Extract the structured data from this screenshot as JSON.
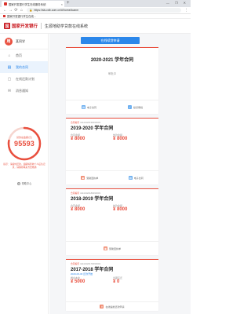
{
  "browser": {
    "tab_title": "国家开发银行学生在线服务系统",
    "tab_close": "×",
    "new_tab": "+",
    "window_controls": "— ❐ ✕",
    "back": "←",
    "forward": "→",
    "reload": "⟳",
    "home": "⌂",
    "lock": "🔒",
    "url": "https://sls.cdb.com.cn/#/home/loanm",
    "menu": "⋮",
    "bookmark_label": "国家开发银行学生在线..."
  },
  "header": {
    "logo_mark": "国",
    "logo_text": "国家开发银行",
    "site_title": "生源地助学贷款在线系统"
  },
  "sidebar": {
    "avatar_text": "用",
    "user_name": "某同学",
    "items": [
      {
        "icon": "home-icon",
        "glyph": "⌂",
        "label": "首页"
      },
      {
        "icon": "contract-icon",
        "glyph": "▤",
        "label": "我的合同"
      },
      {
        "icon": "repay-icon",
        "glyph": "▢",
        "label": "在线还款计划"
      },
      {
        "icon": "message-icon",
        "glyph": "✉",
        "label": "消息通知"
      }
    ],
    "circle_label": "贷款总金额(元)",
    "circle_value": "95593",
    "circle_fill": 0.78,
    "note": "提示：请按时还款，逾期将影响个人征信记录，请保持联系方式畅通",
    "help": "帮助中心"
  },
  "main": {
    "apply_button": "在线续贷申请",
    "cards": [
      {
        "title": "2020-2021 学年合同",
        "status": "审批中",
        "actions": [
          "电子合同",
          "续贷审批"
        ]
      },
      {
        "number_label": "合同编号",
        "number": "41110420190090603",
        "title": "2019-2020 学年合同",
        "amounts": [
          {
            "label": "合同金额",
            "value": "¥ 8000"
          },
          {
            "label": "放款金额",
            "value": "¥ 8000"
          }
        ],
        "actions": [
          "受助回执单",
          "电子合同"
        ]
      },
      {
        "number_label": "合同编号",
        "number": "41110420180090603",
        "title": "2018-2019 学年合同",
        "amounts": [
          {
            "label": "合同金额",
            "value": "¥ 8000"
          },
          {
            "label": "放款金额",
            "value": "¥ 8000"
          }
        ],
        "actions": [
          "受助回执单"
        ]
      },
      {
        "number_label": "合同编号",
        "number": "41110420170090603",
        "title": "2017-2018 学年合同",
        "date": "2020-06-30 还款开始",
        "amounts": [
          {
            "label": "剩余本金",
            "value": "¥ 5000"
          },
          {
            "label": "当期应还",
            "value": "¥ 0"
          }
        ],
        "actions": [
          "在线提前还款申请"
        ]
      }
    ]
  },
  "colors": {
    "accent_red": "#e94f3e",
    "brand_red": "#c8161d",
    "primary_blue": "#2b87ea"
  }
}
